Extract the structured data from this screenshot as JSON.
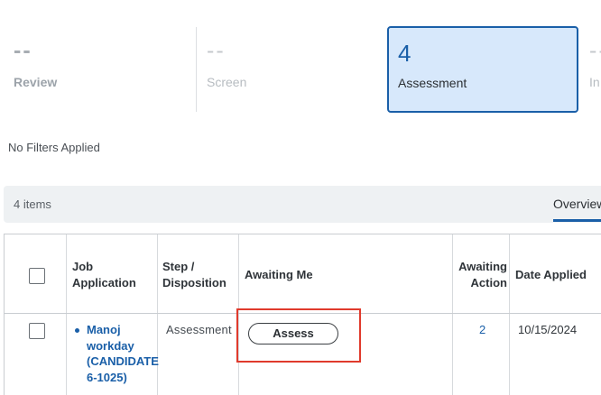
{
  "stages": {
    "review": {
      "count": "--",
      "label": "Review"
    },
    "screen": {
      "count": "--",
      "label": "Screen"
    },
    "assessment": {
      "count": "4",
      "label": "Assessment"
    },
    "interview": {
      "count": "--",
      "label": "In"
    }
  },
  "filters": {
    "text": "No Filters Applied"
  },
  "toolbar": {
    "items_count": "4 items",
    "tab_overview": "Overview"
  },
  "table": {
    "headers": {
      "job_application": "Job Application",
      "step_disposition": "Step / Disposition",
      "awaiting_me": "Awaiting Me",
      "awaiting_action": "Awaiting Action",
      "date_applied": "Date Applied"
    },
    "rows": [
      {
        "job_application": "Manoj workday (CANDIDATE 6-1025)",
        "step": "Assessment",
        "awaiting_me_button": "Assess",
        "awaiting_action": "2",
        "date_applied": "10/15/2024"
      }
    ]
  },
  "colors": {
    "accent": "#1a5fa8",
    "highlight": "#e03a2c",
    "selected_stage_bg": "#d7e8fb"
  }
}
